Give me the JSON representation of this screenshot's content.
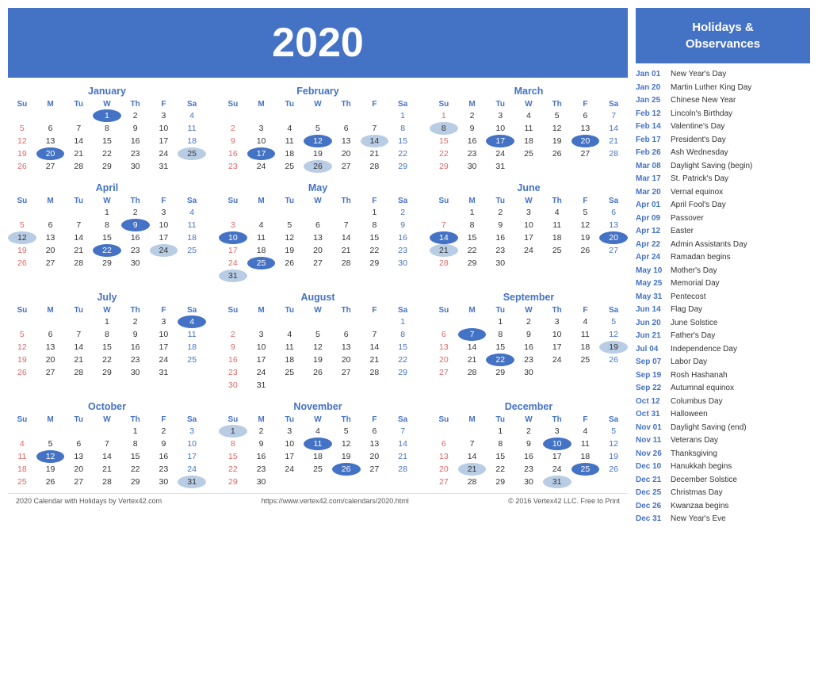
{
  "year": "2020",
  "footer": {
    "left": "2020 Calendar with Holidays by Vertex42.com",
    "center": "https://www.vertex42.com/calendars/2020.html",
    "right": "© 2016 Vertex42 LLC. Free to Print"
  },
  "holidays_header": "Holidays &\nObservances",
  "holidays": [
    {
      "date": "Jan 01",
      "name": "New Year's Day"
    },
    {
      "date": "Jan 20",
      "name": "Martin Luther King Day"
    },
    {
      "date": "Jan 25",
      "name": "Chinese New Year"
    },
    {
      "date": "Feb 12",
      "name": "Lincoln's Birthday"
    },
    {
      "date": "Feb 14",
      "name": "Valentine's Day"
    },
    {
      "date": "Feb 17",
      "name": "President's Day"
    },
    {
      "date": "Feb 26",
      "name": "Ash Wednesday"
    },
    {
      "date": "Mar 08",
      "name": "Daylight Saving (begin)"
    },
    {
      "date": "Mar 17",
      "name": "St. Patrick's Day"
    },
    {
      "date": "Mar 20",
      "name": "Vernal equinox"
    },
    {
      "date": "Apr 01",
      "name": "April Fool's Day"
    },
    {
      "date": "Apr 09",
      "name": "Passover"
    },
    {
      "date": "Apr 12",
      "name": "Easter"
    },
    {
      "date": "Apr 22",
      "name": "Admin Assistants Day"
    },
    {
      "date": "Apr 24",
      "name": "Ramadan begins"
    },
    {
      "date": "May 10",
      "name": "Mother's Day"
    },
    {
      "date": "May 25",
      "name": "Memorial Day"
    },
    {
      "date": "May 31",
      "name": "Pentecost"
    },
    {
      "date": "Jun 14",
      "name": "Flag Day"
    },
    {
      "date": "Jun 20",
      "name": "June Solstice"
    },
    {
      "date": "Jun 21",
      "name": "Father's Day"
    },
    {
      "date": "Jul 04",
      "name": "Independence Day"
    },
    {
      "date": "Sep 07",
      "name": "Labor Day"
    },
    {
      "date": "Sep 19",
      "name": "Rosh Hashanah"
    },
    {
      "date": "Sep 22",
      "name": "Autumnal equinox"
    },
    {
      "date": "Oct 12",
      "name": "Columbus Day"
    },
    {
      "date": "Oct 31",
      "name": "Halloween"
    },
    {
      "date": "Nov 01",
      "name": "Daylight Saving (end)"
    },
    {
      "date": "Nov 11",
      "name": "Veterans Day"
    },
    {
      "date": "Nov 26",
      "name": "Thanksgiving"
    },
    {
      "date": "Dec 10",
      "name": "Hanukkah begins"
    },
    {
      "date": "Dec 21",
      "name": "December Solstice"
    },
    {
      "date": "Dec 25",
      "name": "Christmas Day"
    },
    {
      "date": "Dec 26",
      "name": "Kwanzaa begins"
    },
    {
      "date": "Dec 31",
      "name": "New Year's Eve"
    }
  ],
  "months": [
    {
      "name": "January",
      "weeks": [
        [
          null,
          null,
          null,
          1,
          2,
          3,
          4
        ],
        [
          5,
          6,
          7,
          8,
          9,
          10,
          11
        ],
        [
          12,
          13,
          14,
          15,
          16,
          17,
          18
        ],
        [
          19,
          20,
          21,
          22,
          23,
          24,
          25
        ],
        [
          26,
          27,
          28,
          29,
          30,
          31,
          null
        ]
      ],
      "highlights_blue": [
        1,
        20
      ],
      "highlights_light": [
        25
      ]
    },
    {
      "name": "February",
      "weeks": [
        [
          null,
          null,
          null,
          null,
          null,
          null,
          1
        ],
        [
          2,
          3,
          4,
          5,
          6,
          7,
          8
        ],
        [
          9,
          10,
          11,
          12,
          13,
          14,
          15
        ],
        [
          16,
          17,
          18,
          19,
          20,
          21,
          22
        ],
        [
          23,
          24,
          25,
          26,
          27,
          28,
          29
        ]
      ],
      "highlights_blue": [
        12,
        17
      ],
      "highlights_light": [
        14,
        26
      ]
    },
    {
      "name": "March",
      "weeks": [
        [
          1,
          2,
          3,
          4,
          5,
          6,
          7
        ],
        [
          8,
          9,
          10,
          11,
          12,
          13,
          14
        ],
        [
          15,
          16,
          17,
          18,
          19,
          20,
          21
        ],
        [
          22,
          23,
          24,
          25,
          26,
          27,
          28
        ],
        [
          29,
          30,
          31,
          null,
          null,
          null,
          null
        ]
      ],
      "highlights_blue": [
        17,
        20
      ],
      "highlights_light": [
        8
      ]
    },
    {
      "name": "April",
      "weeks": [
        [
          null,
          null,
          null,
          1,
          2,
          3,
          4
        ],
        [
          5,
          6,
          7,
          8,
          9,
          10,
          11
        ],
        [
          12,
          13,
          14,
          15,
          16,
          17,
          18
        ],
        [
          19,
          20,
          21,
          22,
          23,
          24,
          25
        ],
        [
          26,
          27,
          28,
          29,
          30,
          null,
          null
        ]
      ],
      "highlights_blue": [
        9,
        22
      ],
      "highlights_light": [
        12,
        24
      ]
    },
    {
      "name": "May",
      "weeks": [
        [
          null,
          null,
          null,
          null,
          null,
          1,
          2
        ],
        [
          3,
          4,
          5,
          6,
          7,
          8,
          9
        ],
        [
          10,
          11,
          12,
          13,
          14,
          15,
          16
        ],
        [
          17,
          18,
          19,
          20,
          21,
          22,
          23
        ],
        [
          24,
          25,
          26,
          27,
          28,
          29,
          30
        ],
        [
          31,
          null,
          null,
          null,
          null,
          null,
          null
        ]
      ],
      "highlights_blue": [
        10,
        25
      ],
      "highlights_light": [
        31
      ]
    },
    {
      "name": "June",
      "weeks": [
        [
          null,
          1,
          2,
          3,
          4,
          5,
          6
        ],
        [
          7,
          8,
          9,
          10,
          11,
          12,
          13
        ],
        [
          14,
          15,
          16,
          17,
          18,
          19,
          20
        ],
        [
          21,
          22,
          23,
          24,
          25,
          26,
          27
        ],
        [
          28,
          29,
          30,
          null,
          null,
          null,
          null
        ]
      ],
      "highlights_blue": [
        14,
        20
      ],
      "highlights_light": [
        21
      ]
    },
    {
      "name": "July",
      "weeks": [
        [
          null,
          null,
          null,
          1,
          2,
          3,
          4
        ],
        [
          5,
          6,
          7,
          8,
          9,
          10,
          11
        ],
        [
          12,
          13,
          14,
          15,
          16,
          17,
          18
        ],
        [
          19,
          20,
          21,
          22,
          23,
          24,
          25
        ],
        [
          26,
          27,
          28,
          29,
          30,
          31,
          null
        ]
      ],
      "highlights_blue": [
        4
      ],
      "highlights_light": []
    },
    {
      "name": "August",
      "weeks": [
        [
          null,
          null,
          null,
          null,
          null,
          null,
          1
        ],
        [
          2,
          3,
          4,
          5,
          6,
          7,
          8
        ],
        [
          9,
          10,
          11,
          12,
          13,
          14,
          15
        ],
        [
          16,
          17,
          18,
          19,
          20,
          21,
          22
        ],
        [
          23,
          24,
          25,
          26,
          27,
          28,
          29
        ],
        [
          30,
          31,
          null,
          null,
          null,
          null,
          null
        ]
      ],
      "highlights_blue": [],
      "highlights_light": []
    },
    {
      "name": "September",
      "weeks": [
        [
          null,
          null,
          1,
          2,
          3,
          4,
          5
        ],
        [
          6,
          7,
          8,
          9,
          10,
          11,
          12
        ],
        [
          13,
          14,
          15,
          16,
          17,
          18,
          19
        ],
        [
          20,
          21,
          22,
          23,
          24,
          25,
          26
        ],
        [
          27,
          28,
          29,
          30,
          null,
          null,
          null
        ]
      ],
      "highlights_blue": [
        7,
        22
      ],
      "highlights_light": [
        19
      ]
    },
    {
      "name": "October",
      "weeks": [
        [
          null,
          null,
          null,
          null,
          1,
          2,
          3
        ],
        [
          4,
          5,
          6,
          7,
          8,
          9,
          10
        ],
        [
          11,
          12,
          13,
          14,
          15,
          16,
          17
        ],
        [
          18,
          19,
          20,
          21,
          22,
          23,
          24
        ],
        [
          25,
          26,
          27,
          28,
          29,
          30,
          31
        ]
      ],
      "highlights_blue": [
        12
      ],
      "highlights_light": [
        31
      ]
    },
    {
      "name": "November",
      "weeks": [
        [
          1,
          2,
          3,
          4,
          5,
          6,
          7
        ],
        [
          8,
          9,
          10,
          11,
          12,
          13,
          14
        ],
        [
          15,
          16,
          17,
          18,
          19,
          20,
          21
        ],
        [
          22,
          23,
          24,
          25,
          26,
          27,
          28
        ],
        [
          29,
          30,
          null,
          null,
          null,
          null,
          null
        ]
      ],
      "highlights_blue": [
        11,
        26
      ],
      "highlights_light": [
        1
      ]
    },
    {
      "name": "December",
      "weeks": [
        [
          null,
          null,
          1,
          2,
          3,
          4,
          5
        ],
        [
          6,
          7,
          8,
          9,
          10,
          11,
          12
        ],
        [
          13,
          14,
          15,
          16,
          17,
          18,
          19
        ],
        [
          20,
          21,
          22,
          23,
          24,
          25,
          26
        ],
        [
          27,
          28,
          29,
          30,
          31,
          null,
          null
        ]
      ],
      "highlights_blue": [
        10,
        25
      ],
      "highlights_light": [
        21,
        31
      ]
    }
  ],
  "days_header": [
    "Su",
    "M",
    "Tu",
    "W",
    "Th",
    "F",
    "Sa"
  ]
}
